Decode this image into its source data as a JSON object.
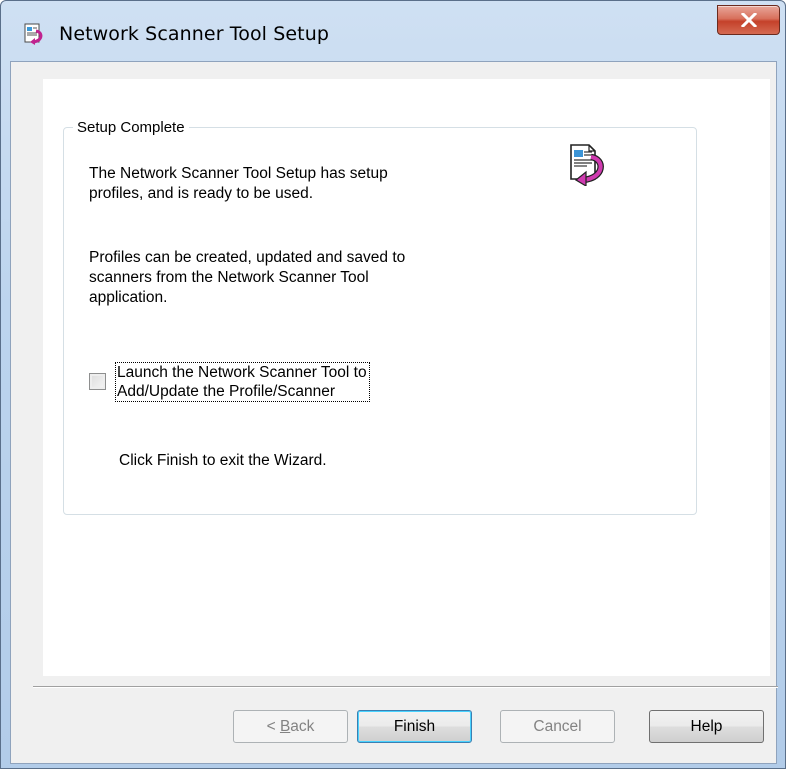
{
  "window": {
    "title": "Network Scanner Tool Setup",
    "title_icon": "setup-wizard-icon",
    "close_icon": "close-icon"
  },
  "group": {
    "legend": "Setup Complete",
    "para1_line1": "The Network Scanner Tool Setup has setup",
    "para1_line2": "profiles, and is ready to be used.",
    "para2_line1": "Profiles can be created, updated and saved to",
    "para2_line2": "scanners from the Network Scanner Tool",
    "para2_line3": "application.",
    "checkbox": {
      "checked": false,
      "label_line1": "Launch the Network Scanner Tool to",
      "label_line2": "Add/Update the Profile/Scanner"
    },
    "finish_hint": "Click Finish to exit the Wizard.",
    "icon": "document-arrow-icon"
  },
  "buttons": {
    "back_prefix": "< ",
    "back_mnemonic": "B",
    "back_rest": "ack",
    "finish": "Finish",
    "cancel": "Cancel",
    "help": "Help"
  }
}
